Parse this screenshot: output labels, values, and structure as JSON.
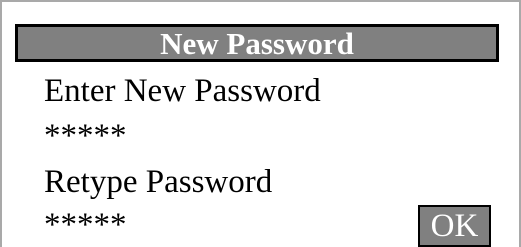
{
  "dialog": {
    "title": "New Password",
    "enter_label": "Enter New Password",
    "enter_value": "*****",
    "retype_label": "Retype Password",
    "retype_value": "*****",
    "ok_label": "OK"
  },
  "colors": {
    "title_bar_bg": "#808080",
    "title_text": "#ffffff",
    "ok_button_bg": "#808080",
    "text": "#000000",
    "border": "#000000",
    "frame": "#a9a9a9",
    "background": "#ffffff"
  }
}
